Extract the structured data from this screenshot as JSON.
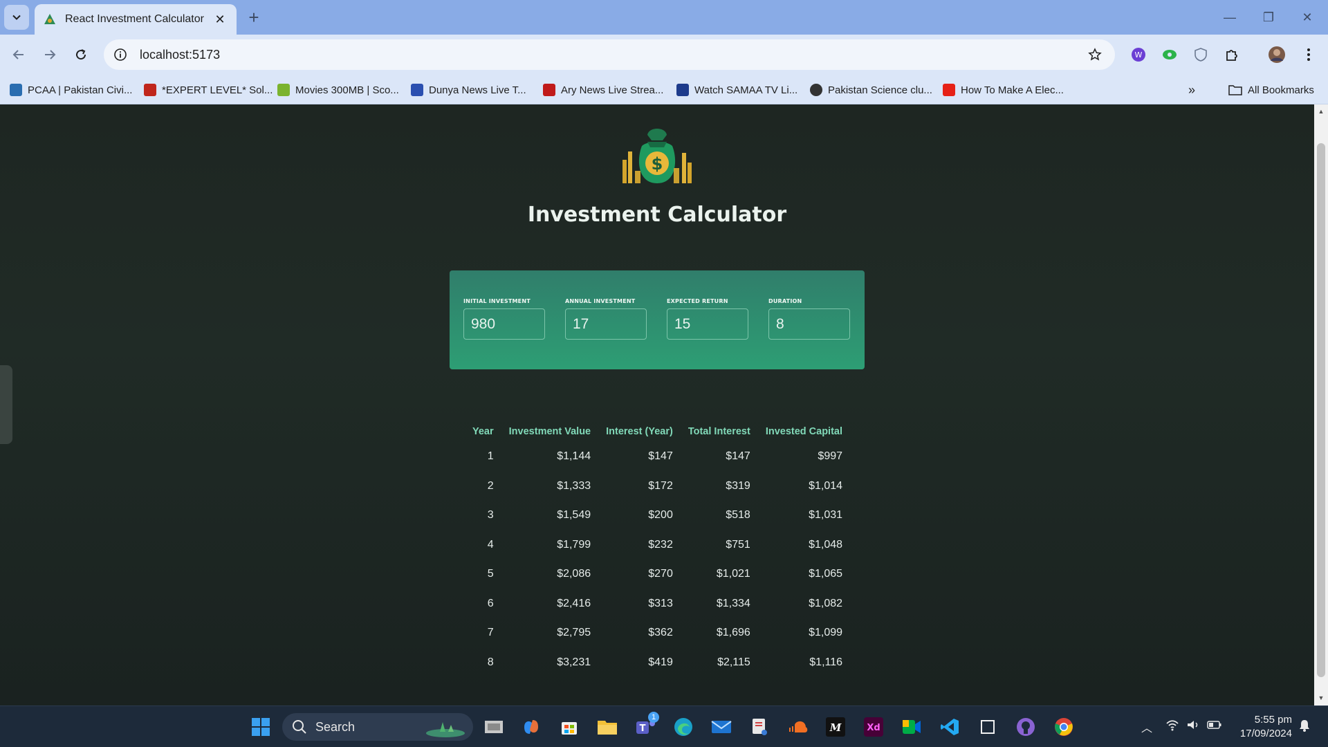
{
  "browser": {
    "tab_title": "React Investment Calculator",
    "url": "localhost:5173",
    "bookmarks": [
      {
        "label": "PCAA | Pakistan Civi...",
        "color": "#2a6db0"
      },
      {
        "label": "*EXPERT LEVEL* Sol...",
        "color": "#c0261c"
      },
      {
        "label": "Movies 300MB | Sco...",
        "color": "#7bb32e"
      },
      {
        "label": "Dunya News Live T...",
        "color": "#2b4fb0"
      },
      {
        "label": "Ary News Live Strea...",
        "color": "#c01a1a"
      },
      {
        "label": "Watch SAMAA TV Li...",
        "color": "#1d3b8c"
      },
      {
        "label": "Pakistan Science clu...",
        "color": "#333333"
      },
      {
        "label": "How To Make A Elec...",
        "color": "#e62117"
      }
    ],
    "all_bookmarks_label": "All Bookmarks"
  },
  "app": {
    "title": "Investment Calculator",
    "inputs": [
      {
        "label": "INITIAL INVESTMENT",
        "value": "980"
      },
      {
        "label": "ANNUAL INVESTMENT",
        "value": "17"
      },
      {
        "label": "EXPECTED RETURN",
        "value": "15"
      },
      {
        "label": "DURATION",
        "value": "8"
      }
    ],
    "table": {
      "headers": [
        "Year",
        "Investment Value",
        "Interest (Year)",
        "Total Interest",
        "Invested Capital"
      ],
      "rows": [
        [
          "1",
          "$1,144",
          "$147",
          "$147",
          "$997"
        ],
        [
          "2",
          "$1,333",
          "$172",
          "$319",
          "$1,014"
        ],
        [
          "3",
          "$1,549",
          "$200",
          "$518",
          "$1,031"
        ],
        [
          "4",
          "$1,799",
          "$232",
          "$751",
          "$1,048"
        ],
        [
          "5",
          "$2,086",
          "$270",
          "$1,021",
          "$1,065"
        ],
        [
          "6",
          "$2,416",
          "$313",
          "$1,334",
          "$1,082"
        ],
        [
          "7",
          "$2,795",
          "$362",
          "$1,696",
          "$1,099"
        ],
        [
          "8",
          "$3,231",
          "$419",
          "$2,115",
          "$1,116"
        ]
      ]
    },
    "colors": {
      "card_top": "#307e6b",
      "card_bottom": "#2d9e74",
      "header_text": "#81d9b8"
    }
  },
  "taskbar": {
    "search_label": "Search",
    "teams_badge": "1",
    "time": "5:55 pm",
    "date": "17/09/2024"
  }
}
